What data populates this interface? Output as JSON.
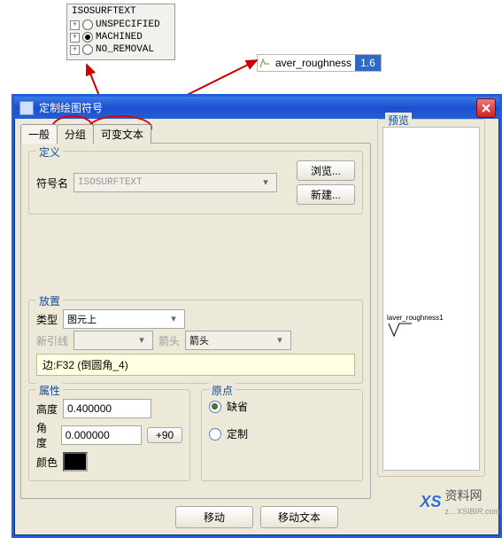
{
  "tree": {
    "title": "ISOSURFTEXT",
    "items": [
      {
        "label": "UNSPECIFIED",
        "selected": false
      },
      {
        "label": "MACHINED",
        "selected": true
      },
      {
        "label": "NO_REMOVAL",
        "selected": false
      }
    ]
  },
  "roughness": {
    "label": "aver_roughness",
    "value": "1.6"
  },
  "dialog": {
    "title": "定制绘图符号",
    "tabs": {
      "general": "一般",
      "group": "分组",
      "vartext": "可变文本"
    },
    "preview_label": "预览",
    "preview_symbol_text": "laver_roughness1",
    "definition": {
      "legend": "定义",
      "name_label": "符号名",
      "name_value": "ISOSURFTEXT",
      "browse": "浏览...",
      "new": "新建..."
    },
    "location": {
      "legend": "放置",
      "type_label": "类型",
      "type_value": "图元上",
      "leader_label": "新引线",
      "arrow_label": "箭头",
      "arrow_value": "箭头",
      "edge_text": "边:F32 (倒圆角_4)"
    },
    "attributes": {
      "legend": "属性",
      "height_label": "高度",
      "height_value": "0.400000",
      "angle_label": "角度",
      "angle_value": "0.000000",
      "plus90": "+90",
      "color_label": "颜色"
    },
    "origin": {
      "legend": "原点",
      "default": "缺省",
      "custom": "定制"
    },
    "footer": {
      "move": "移动",
      "move_text": "移动文本"
    }
  },
  "watermark": {
    "brand": "XS",
    "text": "资料网",
    "sub": "z…XSIBIR.com"
  }
}
